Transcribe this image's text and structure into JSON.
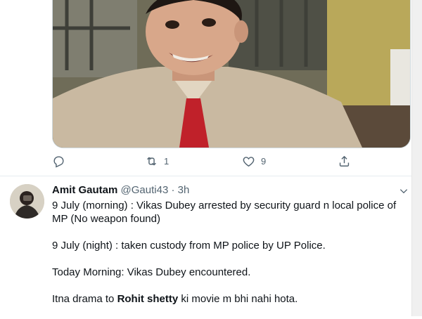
{
  "tweet": {
    "media": {
      "description_icon": "photo-media"
    },
    "actions": {
      "reply_icon": "reply-icon",
      "retweet_icon": "retweet-icon",
      "retweet_count": "1",
      "like_icon": "heart-icon",
      "like_count": "9",
      "share_icon": "share-icon"
    }
  },
  "reply": {
    "author_name": "Amit Gautam",
    "author_handle": "@Gauti43",
    "separator": "·",
    "time": "3h",
    "lines": [
      "9 July (morning) : Vikas Dubey arrested by security guard n local police of MP (No weapon found)",
      "9 July (night) : taken custody from MP police by UP Police.",
      "Today Morning: Vikas Dubey encountered."
    ],
    "last_line": {
      "before": "Itna drama to ",
      "bold": "Rohit shetty",
      "after": " ki movie m bhi nahi hota."
    }
  },
  "colors": {
    "icon_gray": "#536471",
    "divider": "#e6ecf0"
  }
}
